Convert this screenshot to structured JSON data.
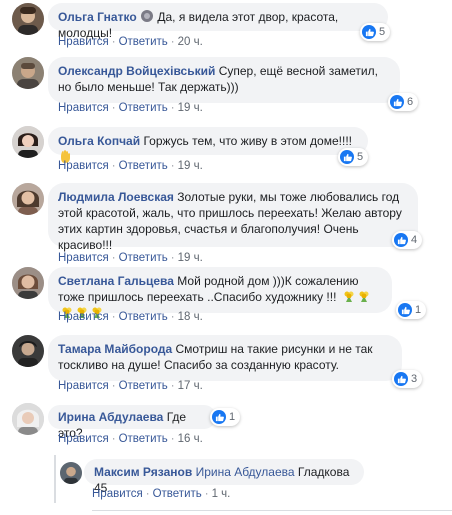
{
  "comments": [
    {
      "author": "Ольга Гнатко",
      "text": "Да, я видела этот двор, красота, молодцы!",
      "like_label": "Нравится",
      "reply_label": "Ответить",
      "time": "20 ч.",
      "reactions": "5"
    },
    {
      "author": "Олександр Войцехівський",
      "text": "Супер, ещё весной заметил, но было меньше! Так держать)))",
      "like_label": "Нравится",
      "reply_label": "Ответить",
      "time": "19 ч.",
      "reactions": "6"
    },
    {
      "author": "Ольга Копчай",
      "text": "Горжусь тем, что живу в этом доме!!!!",
      "like_label": "Нравится",
      "reply_label": "Ответить",
      "time": "19 ч.",
      "reactions": "5"
    },
    {
      "author": "Людмила Лоевская",
      "text": "Золотые руки, мы тоже любовались год этой красотой, жаль, что пришлось переехать! Желаю автору этих картин здоровья, счастья и благополучия! Очень красиво!!!",
      "like_label": "Нравится",
      "reply_label": "Ответить",
      "time": "19 ч.",
      "reactions": "4"
    },
    {
      "author": "Светлана Гальцева",
      "text": "Мой родной дом )))К сожалению тоже пришлось переехать ..Спасибо художнику !!!",
      "like_label": "Нравится",
      "reply_label": "Ответить",
      "time": "18 ч.",
      "reactions": "1"
    },
    {
      "author": "Тамара Майборода",
      "text": "Смотриш на такие рисунки и не так тоскливо на душе! Спасибо за созданную красоту.",
      "like_label": "Нравится",
      "reply_label": "Ответить",
      "time": "17 ч.",
      "reactions": "3"
    },
    {
      "author": "Ирина Абдулаева",
      "text": "Где это?",
      "like_label": "Нравится",
      "reply_label": "Ответить",
      "time": "16 ч.",
      "reactions": "1"
    }
  ],
  "reply": {
    "author": "Максим Рязанов",
    "mention": "Ирина Абдулаева",
    "text": "Гладкова 45",
    "like_label": "Нравится",
    "reply_label": "Ответить",
    "time": "1 ч."
  },
  "colors": {
    "link": "#385898",
    "bubble": "#f2f3f5",
    "like_blue": "#1877f2",
    "meta": "#606770"
  },
  "icons": {
    "like": "thumbs-up-icon",
    "wave": "waving-hand-icon",
    "flower": "flower-bouquet-icon",
    "gesture": "ok-hand-icon"
  }
}
